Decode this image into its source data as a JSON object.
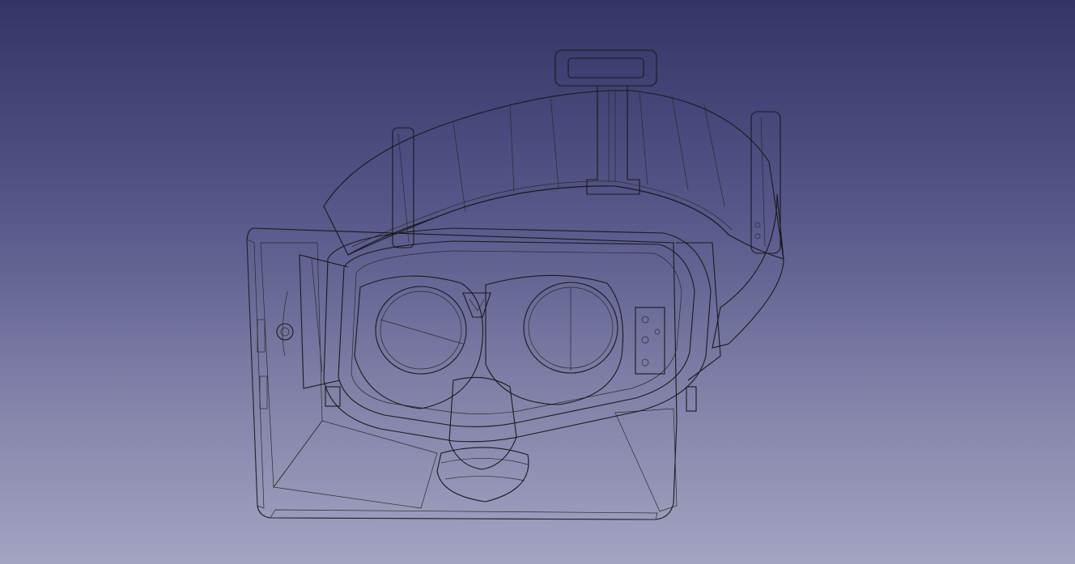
{
  "app": {
    "window_kind": "3d-viewport"
  },
  "viewport": {
    "background_top": "#343466",
    "background_bottom": "#a3a3c2",
    "projection": "perspective"
  },
  "model": {
    "shading": "flat-lines",
    "face_color": "#d4d4d4",
    "edge_color": "#1a1a1a"
  }
}
